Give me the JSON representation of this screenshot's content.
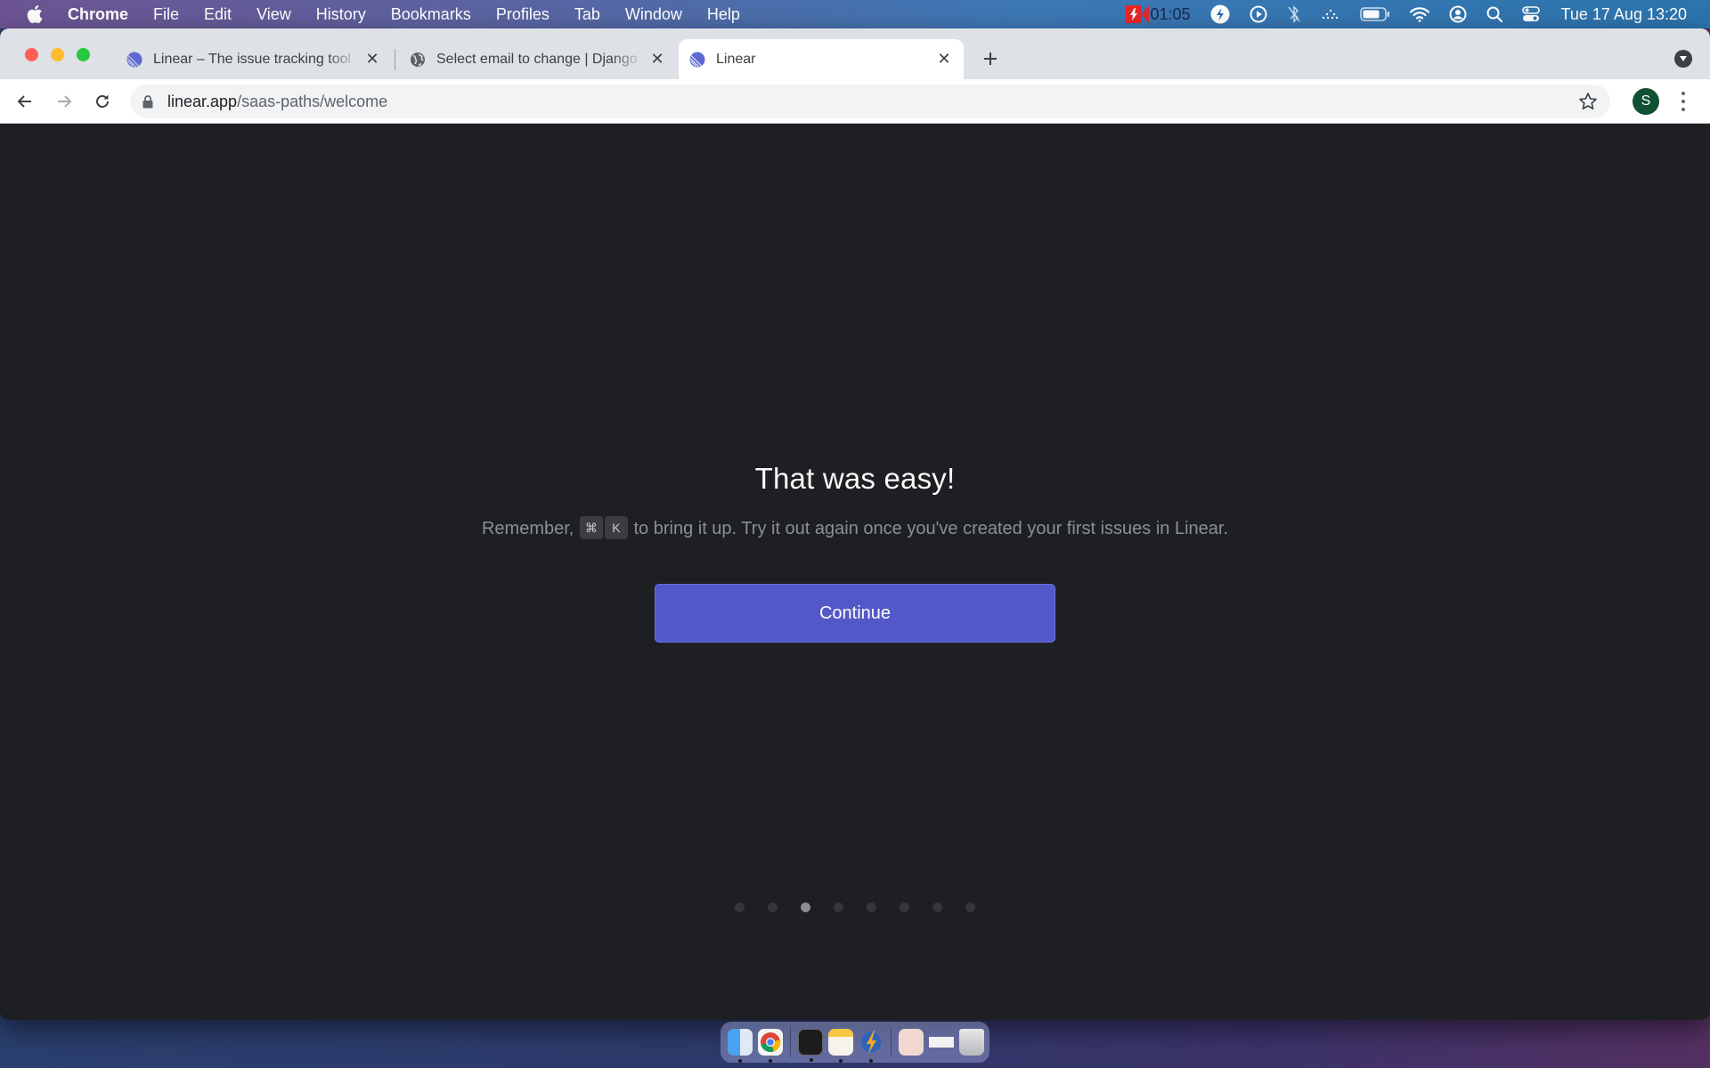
{
  "menubar": {
    "app_name": "Chrome",
    "items": [
      "File",
      "Edit",
      "View",
      "History",
      "Bookmarks",
      "Profiles",
      "Tab",
      "Window",
      "Help"
    ],
    "status": {
      "recording_time": "01:05",
      "icons": [
        "recording-flash-icon",
        "flash-icon",
        "play-circle-icon",
        "bluetooth-off-icon",
        "dots-icon",
        "battery-icon",
        "wifi-icon",
        "user-circle-icon",
        "search-icon",
        "control-center-icon"
      ],
      "clock": "Tue 17 Aug  13:20"
    }
  },
  "browser": {
    "tabs": [
      {
        "title": "Linear – The issue tracking tool",
        "icon": "linear-logo-icon",
        "active": false
      },
      {
        "title": "Select email to change | Django site admin",
        "icon": "globe-icon",
        "active": false
      },
      {
        "title": "Linear",
        "icon": "linear-logo-icon",
        "active": true
      }
    ],
    "address": {
      "host": "linear.app",
      "path": "/saas-paths/welcome"
    },
    "profile_initial": "S",
    "profile_color": "#0f5132"
  },
  "page": {
    "heading": "That was easy!",
    "description_before": "Remember,",
    "shortcut_keys": [
      "⌘",
      "K"
    ],
    "description_after": "to bring it up. Try it out again once you've created your first issues in Linear.",
    "continue_label": "Continue",
    "accent_color": "#5358c8",
    "steps": {
      "total": 8,
      "current": 3
    }
  },
  "dock": {
    "apps": [
      "Finder",
      "Chrome",
      "Terminal",
      "Notes",
      "Reeder",
      "Document",
      "Screenshot",
      "Trash"
    ]
  }
}
